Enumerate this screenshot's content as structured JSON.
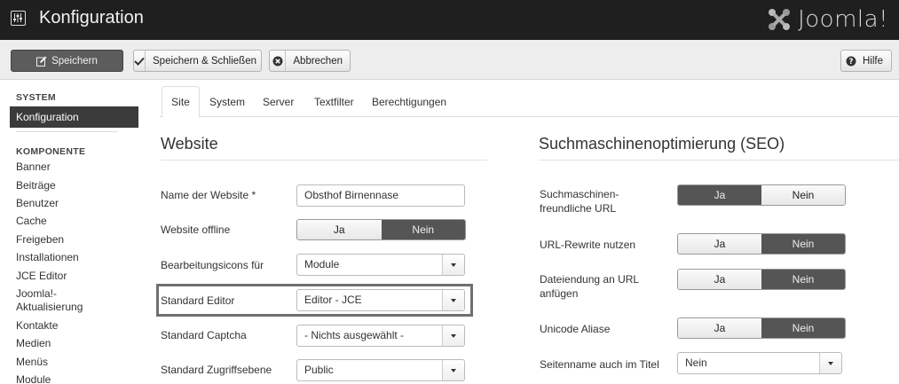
{
  "header": {
    "title": "Konfiguration",
    "logo_text": "Joomla!",
    "cfg_icon": "sliders-icon",
    "logo_icon": "joomla-logo-icon"
  },
  "toolbar": {
    "save_label": "Speichern",
    "save_close_label": "Speichern & Schließen",
    "cancel_label": "Abbrechen",
    "help_label": "Hilfe"
  },
  "sidebar": {
    "system_heading": "SYSTEM",
    "active_item": "Konfiguration",
    "component_heading": "KOMPONENTE",
    "items": [
      "Banner",
      "Beiträge",
      "Benutzer",
      "Cache",
      "Freigeben",
      "Installationen",
      "JCE Editor",
      "Joomla!-",
      "Aktualisierung",
      "Kontakte",
      "Medien",
      "Menüs",
      "Module"
    ]
  },
  "tabs": [
    "Site",
    "System",
    "Server",
    "Textfilter",
    "Berechtigungen"
  ],
  "website": {
    "title": "Website",
    "fields": {
      "site_name_label": "Name der Website *",
      "site_name_value": "Obsthof Birnennase",
      "offline_label": "Website offline",
      "offline_yes": "Ja",
      "offline_no": "Nein",
      "edit_icons_label": "Bearbeitungsicons für",
      "edit_icons_value": "Module",
      "editor_label": "Standard Editor",
      "editor_value": "Editor - JCE",
      "captcha_label": "Standard Captcha",
      "captcha_value": "- Nichts ausgewählt -",
      "access_label": "Standard Zugriffsebene",
      "access_value": "Public"
    }
  },
  "seo": {
    "title": "Suchmaschinenoptimierung (SEO)",
    "sef_label_1": "Suchmaschinen-",
    "sef_label_2": "freundliche URL",
    "sef_yes": "Ja",
    "sef_no": "Nein",
    "rewrite_label": "URL-Rewrite nutzen",
    "rewrite_yes": "Ja",
    "rewrite_no": "Nein",
    "suffix_label_1": "Dateiendung an URL",
    "suffix_label_2": "anfügen",
    "suffix_yes": "Ja",
    "suffix_no": "Nein",
    "unicode_label": "Unicode Aliase",
    "unicode_yes": "Ja",
    "unicode_no": "Nein",
    "sitename_label": "Seitenname auch im Titel",
    "sitename_value": "Nein"
  }
}
